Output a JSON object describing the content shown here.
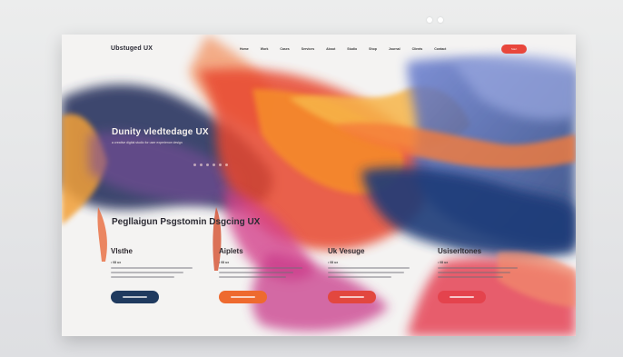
{
  "site": {
    "logo": "Ubstuged UX",
    "nav": [
      "Home",
      "Work",
      "Cases",
      "Services",
      "About",
      "Studio",
      "Shop",
      "Journal",
      "Clients",
      "Contact"
    ],
    "cta_label": "Start"
  },
  "hero": {
    "title": "Dunity vledtedage UX",
    "subtitle": "a creative digital studio for user experience design"
  },
  "section": {
    "title": "Pegllaigun Psgstomin Dsgcing UX"
  },
  "cards": [
    {
      "title": "Vlsthe",
      "meta": "• 08 ux",
      "button_color": "#1f3a5f"
    },
    {
      "title": "Aiplets",
      "meta": "• 08 ux",
      "button_color": "#ee6a2f"
    },
    {
      "title": "Uk Vesuge",
      "meta": "• 08 ux",
      "button_color": "#e2473f"
    },
    {
      "title": "Usiserltones",
      "meta": "• 08 ux",
      "button_color": "#e4434d"
    }
  ],
  "colors": {
    "accent": "#e8473c",
    "navy": "#1f3a5f",
    "orange": "#ee6a2f"
  },
  "icons": [
    "window-dots-icon"
  ]
}
